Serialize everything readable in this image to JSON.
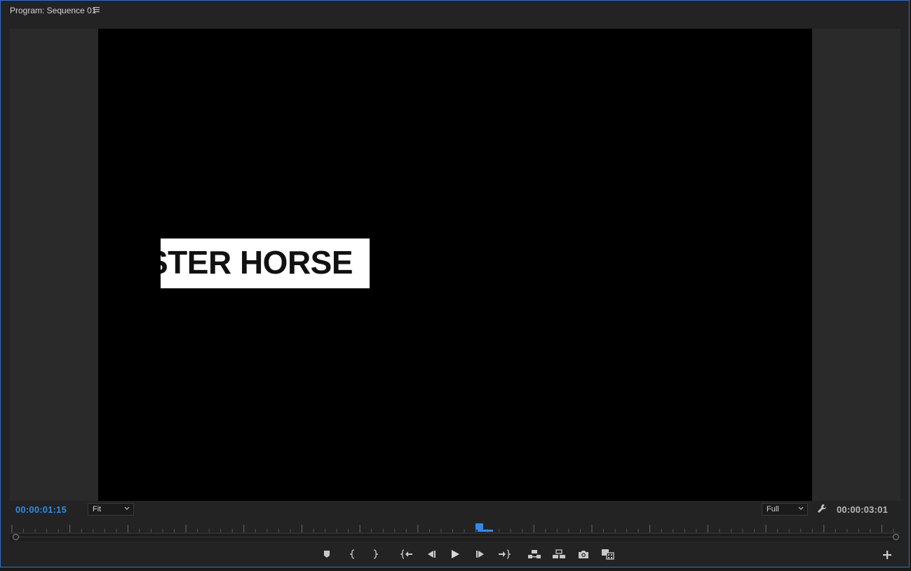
{
  "panel": {
    "title": "Program: Sequence 01"
  },
  "frame": {
    "title_card_text": "STER HORSE"
  },
  "timecode": {
    "current": "00:00:01:15",
    "duration": "00:00:03:01"
  },
  "zoom_select": {
    "value": "Fit"
  },
  "resolution_select": {
    "value": "Full"
  },
  "playhead": {
    "position_fraction": 0.525
  },
  "colors": {
    "accent": "#2d8ceb",
    "panel_border": "#2d6fd4",
    "panel_bg": "#232323"
  },
  "controls": [
    "add-marker-icon",
    "mark-in-icon",
    "mark-out-icon",
    "go-to-in-icon",
    "step-back-icon",
    "play-icon",
    "step-forward-icon",
    "go-to-out-icon",
    "lift-icon",
    "extract-icon",
    "export-frame-icon",
    "comparison-view-icon",
    "add-button-icon"
  ]
}
